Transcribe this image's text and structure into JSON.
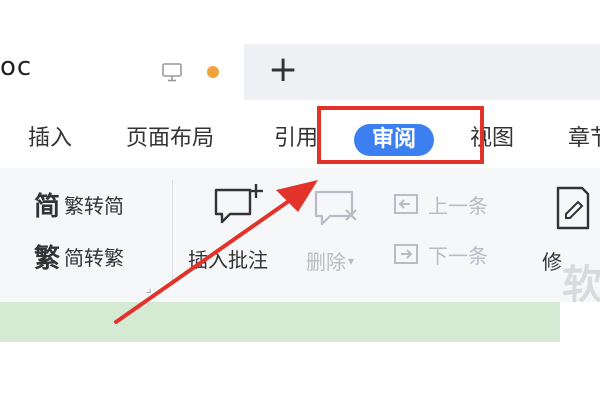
{
  "window": {
    "doc_tab_title": "oc",
    "new_tab_label": "+"
  },
  "menu": {
    "items": [
      "插入",
      "页面布局",
      "引用",
      "审阅",
      "视图",
      "章节"
    ],
    "active_item": "审阅"
  },
  "ribbon": {
    "trad_to_simp": {
      "icon_char": "简",
      "label": "繁转简"
    },
    "simp_to_trad": {
      "icon_char": "繁",
      "label": "简转繁"
    },
    "insert_comment": "插入批注",
    "delete": "删除",
    "prev_comment": "上一条",
    "next_comment": "下一条",
    "modify_partial": "修",
    "watermark_char": "软"
  },
  "colors": {
    "active_tab_bg": "#3b7ff0",
    "highlight_box": "#e2332a",
    "arrow": "#e2332a",
    "doc_area": "#d5ead3",
    "unsaved_dot": "#f0a23c"
  },
  "icons": {
    "monitor": "monitor-icon",
    "unsaved": "unsaved-dot",
    "insert_comment": "comment-add-icon",
    "delete": "comment-delete-icon",
    "prev": "previous-comment-icon",
    "next": "next-comment-icon",
    "edit": "edit-document-icon"
  }
}
